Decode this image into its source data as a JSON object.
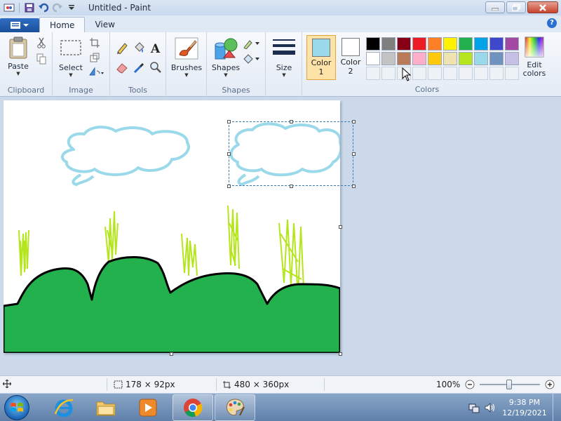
{
  "window": {
    "title": "Untitled - Paint"
  },
  "tabs": [
    {
      "label": "Home"
    },
    {
      "label": "View"
    }
  ],
  "ribbon": {
    "clipboard": {
      "paste_label": "Paste",
      "group_label": "Clipboard"
    },
    "image": {
      "select_label": "Select",
      "group_label": "Image"
    },
    "tools": {
      "group_label": "Tools"
    },
    "brushes": {
      "label": "Brushes"
    },
    "shapes": {
      "label": "Shapes",
      "group_label": "Shapes"
    },
    "size": {
      "label": "Size"
    },
    "colors": {
      "color1_label": "Color",
      "color1_num": "1",
      "color2_label": "Color",
      "color2_num": "2",
      "edit_label": "Edit",
      "edit_label2": "colors",
      "group_label": "Colors",
      "color1_value": "#99d9ea",
      "color2_value": "#ffffff",
      "palette_row1": [
        "#000000",
        "#7f7f7f",
        "#880015",
        "#ed1c24",
        "#ff7f27",
        "#fff200",
        "#22b14c",
        "#00a2e8",
        "#3f48cc",
        "#a349a4"
      ],
      "palette_row2": [
        "#ffffff",
        "#c3c3c3",
        "#b97a57",
        "#ffaec9",
        "#ffc90e",
        "#efe4b0",
        "#b5e61d",
        "#99d9ea",
        "#7092be",
        "#c8bfe7"
      ]
    }
  },
  "status": {
    "selection_size": "178 × 92px",
    "canvas_size": "480 × 360px",
    "zoom": "100%"
  },
  "taskbar": {
    "time": "9:38 PM",
    "date": "12/19/2021"
  }
}
